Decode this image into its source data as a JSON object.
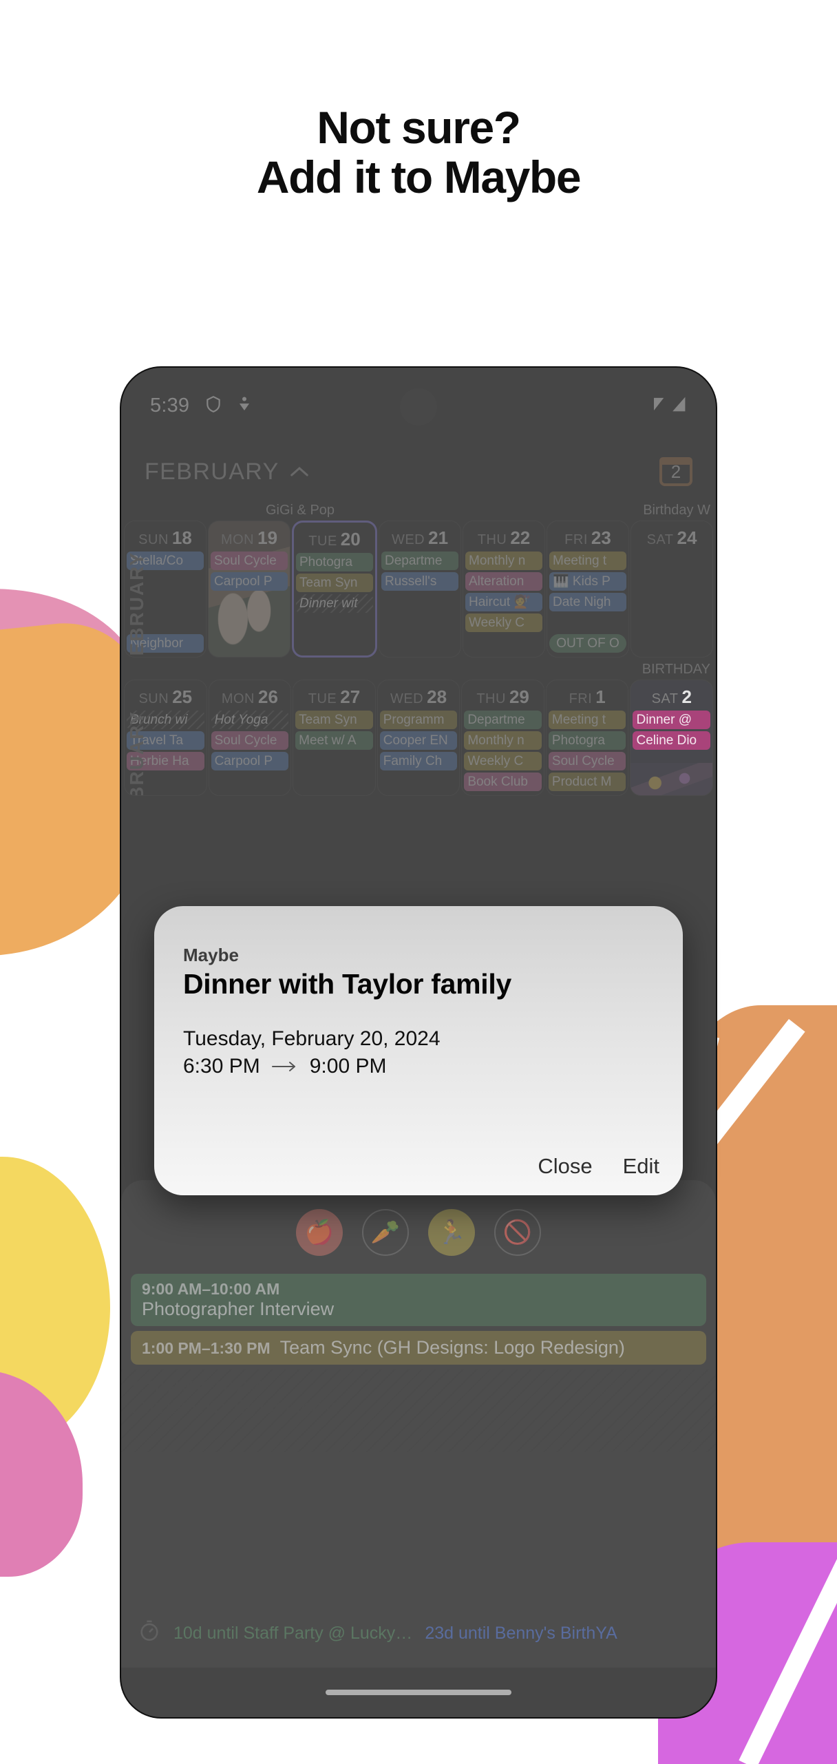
{
  "headline": {
    "line1": "Not sure?",
    "line2": "Add it to Maybe"
  },
  "phone": {
    "status": {
      "time": "5:39",
      "icons": [
        "shield-icon",
        "person-heart-icon",
        "wifi-icon",
        "signal-icon"
      ]
    },
    "header": {
      "month": "FEBRUARY",
      "chevron": "chevron-up-icon",
      "badge_count": "2",
      "badge_icon": "calendar-icon"
    },
    "calendar": {
      "side_label_week1": "FEBRUARY",
      "side_label_week2": "FEBRUARY",
      "weeks": [
        {
          "overhead_left": "GiGi & Pop",
          "overhead_right": "Birthday W",
          "days": [
            {
              "dow": "SUN",
              "num": "18",
              "selected": false,
              "events": [
                {
                  "text": "Stella/Co",
                  "color": "#2f5fa8",
                  "style": "solid"
                },
                {
                  "text": "",
                  "color": "",
                  "style": "spacer"
                },
                {
                  "text": "",
                  "color": "",
                  "style": "spacer"
                },
                {
                  "text": "",
                  "color": "",
                  "style": "spacer"
                },
                {
                  "text": "Neighbor",
                  "color": "#2f5fa8",
                  "style": "solid"
                }
              ]
            },
            {
              "dow": "MON",
              "num": "19",
              "selected": false,
              "photo": "photo-mon19",
              "events": [
                {
                  "text": "Soul Cycle",
                  "color": "#a9437a",
                  "style": "solid"
                },
                {
                  "text": "Carpool P",
                  "color": "#2f5fa8",
                  "style": "solid"
                }
              ]
            },
            {
              "dow": "TUE",
              "num": "20",
              "selected": true,
              "events": [
                {
                  "text": "Photogra",
                  "color": "#2e6440",
                  "style": "solid"
                },
                {
                  "text": "Team Syn",
                  "color": "#7a6a18",
                  "style": "solid"
                },
                {
                  "text": "Dinner wit",
                  "color": "",
                  "style": "ghost"
                }
              ]
            },
            {
              "dow": "WED",
              "num": "21",
              "selected": false,
              "events": [
                {
                  "text": "Departme",
                  "color": "#2e6440",
                  "style": "solid"
                },
                {
                  "text": "Russell's",
                  "color": "#2f5fa8",
                  "style": "solid"
                }
              ]
            },
            {
              "dow": "THU",
              "num": "22",
              "selected": false,
              "events": [
                {
                  "text": "Monthly n",
                  "color": "#8a7519",
                  "style": "solid"
                },
                {
                  "text": "Alteration",
                  "color": "#a9437a",
                  "style": "solid"
                },
                {
                  "text": "Haircut 💇",
                  "color": "#2f5fa8",
                  "style": "solid"
                },
                {
                  "text": "Weekly C",
                  "color": "#8a7519",
                  "style": "solid"
                }
              ]
            },
            {
              "dow": "FRI",
              "num": "23",
              "selected": false,
              "events": [
                {
                  "text": "Meeting t",
                  "color": "#8a7519",
                  "style": "solid"
                },
                {
                  "text": "🎹 Kids P",
                  "color": "#2f5fa8",
                  "style": "solid"
                },
                {
                  "text": "Date Nigh",
                  "color": "#2f5fa8",
                  "style": "solid"
                },
                {
                  "text": "",
                  "color": "",
                  "style": "spacer"
                },
                {
                  "text": "OUT OF O",
                  "color": "#2e6440",
                  "style": "pill"
                }
              ]
            },
            {
              "dow": "SAT",
              "num": "24",
              "selected": false,
              "events": []
            }
          ]
        },
        {
          "overhead_left": "",
          "overhead_right": "BIRTHDAY",
          "days": [
            {
              "dow": "SUN",
              "num": "25",
              "selected": false,
              "events": [
                {
                  "text": "Brunch wi",
                  "color": "",
                  "style": "ghost"
                },
                {
                  "text": "Travel Ta",
                  "color": "#2f5fa8",
                  "style": "solid"
                },
                {
                  "text": "Herbie Ha",
                  "color": "#a9437a",
                  "style": "solid"
                }
              ]
            },
            {
              "dow": "MON",
              "num": "26",
              "selected": false,
              "events": [
                {
                  "text": "Hot Yoga",
                  "color": "",
                  "style": "ghost"
                },
                {
                  "text": "Soul Cycle",
                  "color": "#a9437a",
                  "style": "solid"
                },
                {
                  "text": "Carpool P",
                  "color": "#2f5fa8",
                  "style": "solid"
                }
              ]
            },
            {
              "dow": "TUE",
              "num": "27",
              "selected": false,
              "events": [
                {
                  "text": "Team Syn",
                  "color": "#7a6a18",
                  "style": "solid"
                },
                {
                  "text": "Meet w/ A",
                  "color": "#2e6440",
                  "style": "solid"
                }
              ]
            },
            {
              "dow": "WED",
              "num": "28",
              "selected": false,
              "events": [
                {
                  "text": "Programm",
                  "color": "#7a6a18",
                  "style": "solid"
                },
                {
                  "text": "Cooper EN",
                  "color": "#2f5fa8",
                  "style": "solid"
                },
                {
                  "text": "Family Ch",
                  "color": "#2f5fa8",
                  "style": "solid"
                }
              ]
            },
            {
              "dow": "THU",
              "num": "29",
              "selected": false,
              "events": [
                {
                  "text": "Departme",
                  "color": "#2e6440",
                  "style": "solid"
                },
                {
                  "text": "Monthly n",
                  "color": "#8a7519",
                  "style": "solid"
                },
                {
                  "text": "Weekly C",
                  "color": "#8a7519",
                  "style": "solid"
                },
                {
                  "text": "Book Club",
                  "color": "#a9437a",
                  "style": "solid"
                }
              ]
            },
            {
              "dow": "FRI",
              "num": "1",
              "selected": false,
              "events": [
                {
                  "text": "Meeting t",
                  "color": "#8a7519",
                  "style": "solid"
                },
                {
                  "text": "Photogra",
                  "color": "#2e6440",
                  "style": "solid"
                },
                {
                  "text": "Soul Cycle",
                  "color": "#a9437a",
                  "style": "solid"
                },
                {
                  "text": "Product M",
                  "color": "#7a6a18",
                  "style": "solid"
                }
              ]
            },
            {
              "dow": "SAT",
              "num": "2",
              "selected": false,
              "photo": "photo-sat2",
              "events": [
                {
                  "text": "Dinner @",
                  "color": "#a9437a",
                  "style": "solid"
                },
                {
                  "text": "Celine Dio",
                  "color": "#a9437a",
                  "style": "solid"
                }
              ]
            }
          ]
        }
      ]
    },
    "dayview": {
      "habits": [
        {
          "name": "apple-icon",
          "glyph": "🍎",
          "cls": "apple"
        },
        {
          "name": "carrot-icon",
          "glyph": "🥕",
          "cls": "carrot"
        },
        {
          "name": "running-icon",
          "glyph": "🏃",
          "cls": "run"
        },
        {
          "name": "no-alcohol-icon",
          "glyph": "🚫",
          "cls": "drink"
        }
      ],
      "events": [
        {
          "time": "9:00 AM–10:00 AM",
          "title": "Photographer Interview",
          "variant": "green"
        },
        {
          "time": "1:00 PM–1:30 PM",
          "title": "Team Sync (GH Designs: Logo Redesign)",
          "variant": "olive"
        },
        {
          "time": "6:30 PM–9:00 PM",
          "title": "Dinner with Taylor family",
          "variant": "maybe"
        }
      ],
      "countdowns": {
        "clock_icon": "stopwatch-icon",
        "left": "10d until Staff Party @ Lucky…",
        "right": "23d until Benny's BirthYA"
      }
    }
  },
  "dialog": {
    "kicker": "Maybe",
    "title": "Dinner with Taylor family",
    "date": "Tuesday, February 20, 2024",
    "start_time": "6:30 PM",
    "end_time": "9:00 PM",
    "arrow_icon": "arrow-right-icon",
    "close_label": "Close",
    "edit_label": "Edit"
  },
  "colors": {
    "accent_purple": "#6b5ee0",
    "badge_brown": "#8a501d",
    "blue": "#2f5fa8",
    "pink": "#a9437a",
    "green": "#2e6440",
    "olive": "#8a7519"
  }
}
